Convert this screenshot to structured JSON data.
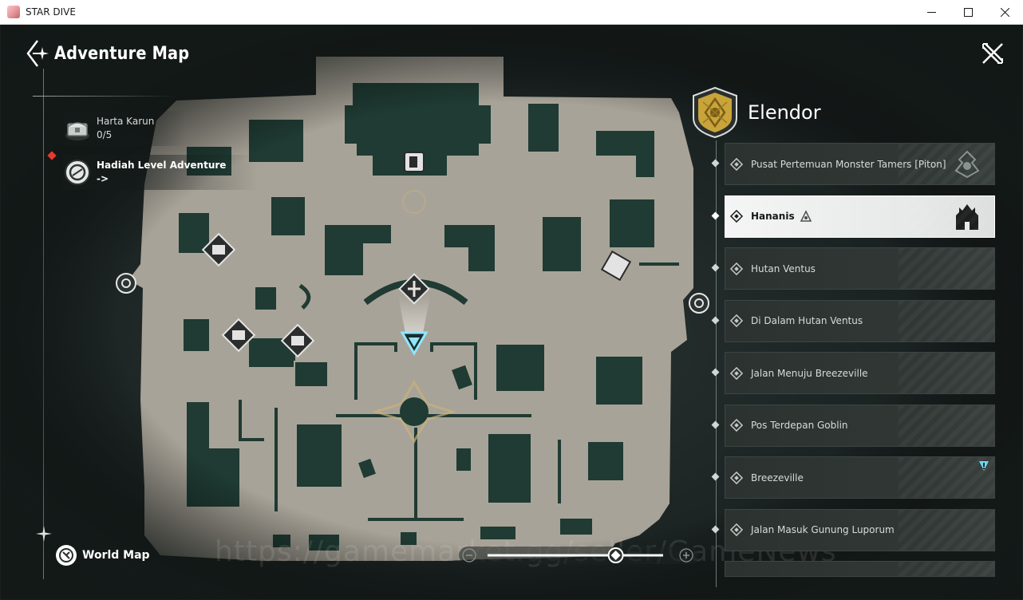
{
  "window": {
    "title": "STAR DIVE",
    "controls": [
      "minimize",
      "maximize",
      "close"
    ]
  },
  "header": {
    "title": "Adventure Map",
    "icon": "compass-sparkle-icon"
  },
  "side_info": {
    "treasure": {
      "label": "Harta Karun",
      "value": "0/5",
      "icon": "treasure-chest-icon"
    },
    "level_reward": {
      "label": "Hadiah Level Adventure",
      "value": "->",
      "icon": "reward-badge-icon"
    }
  },
  "world_map": {
    "label": "World Map",
    "icon": "globe-icon"
  },
  "region": {
    "name": "Elendor",
    "emblem": "gold-crest-icon"
  },
  "locations": [
    {
      "label": "Pusat Pertemuan Monster Tamers [Piton]",
      "active": false
    },
    {
      "label": "Hananis",
      "active": true
    },
    {
      "label": "Hutan Ventus",
      "active": false
    },
    {
      "label": "Di Dalam Hutan Ventus",
      "active": false
    },
    {
      "label": "Jalan Menuju Breezeville",
      "active": false
    },
    {
      "label": "Pos Terdepan Goblin",
      "active": false
    },
    {
      "label": "Breezeville",
      "active": false
    },
    {
      "label": "Jalan Masuk Gunung Luporum",
      "active": false
    }
  ],
  "zoom": {
    "level": 0.73
  },
  "watermark": "https://gamemarket.gg/seller/GameNews",
  "colors": {
    "map_ground": "#a8a398",
    "map_building": "#1f3b33",
    "accent_player": "#8fe6ff",
    "alert": "#e8392e",
    "gold": "#c9a43a"
  }
}
